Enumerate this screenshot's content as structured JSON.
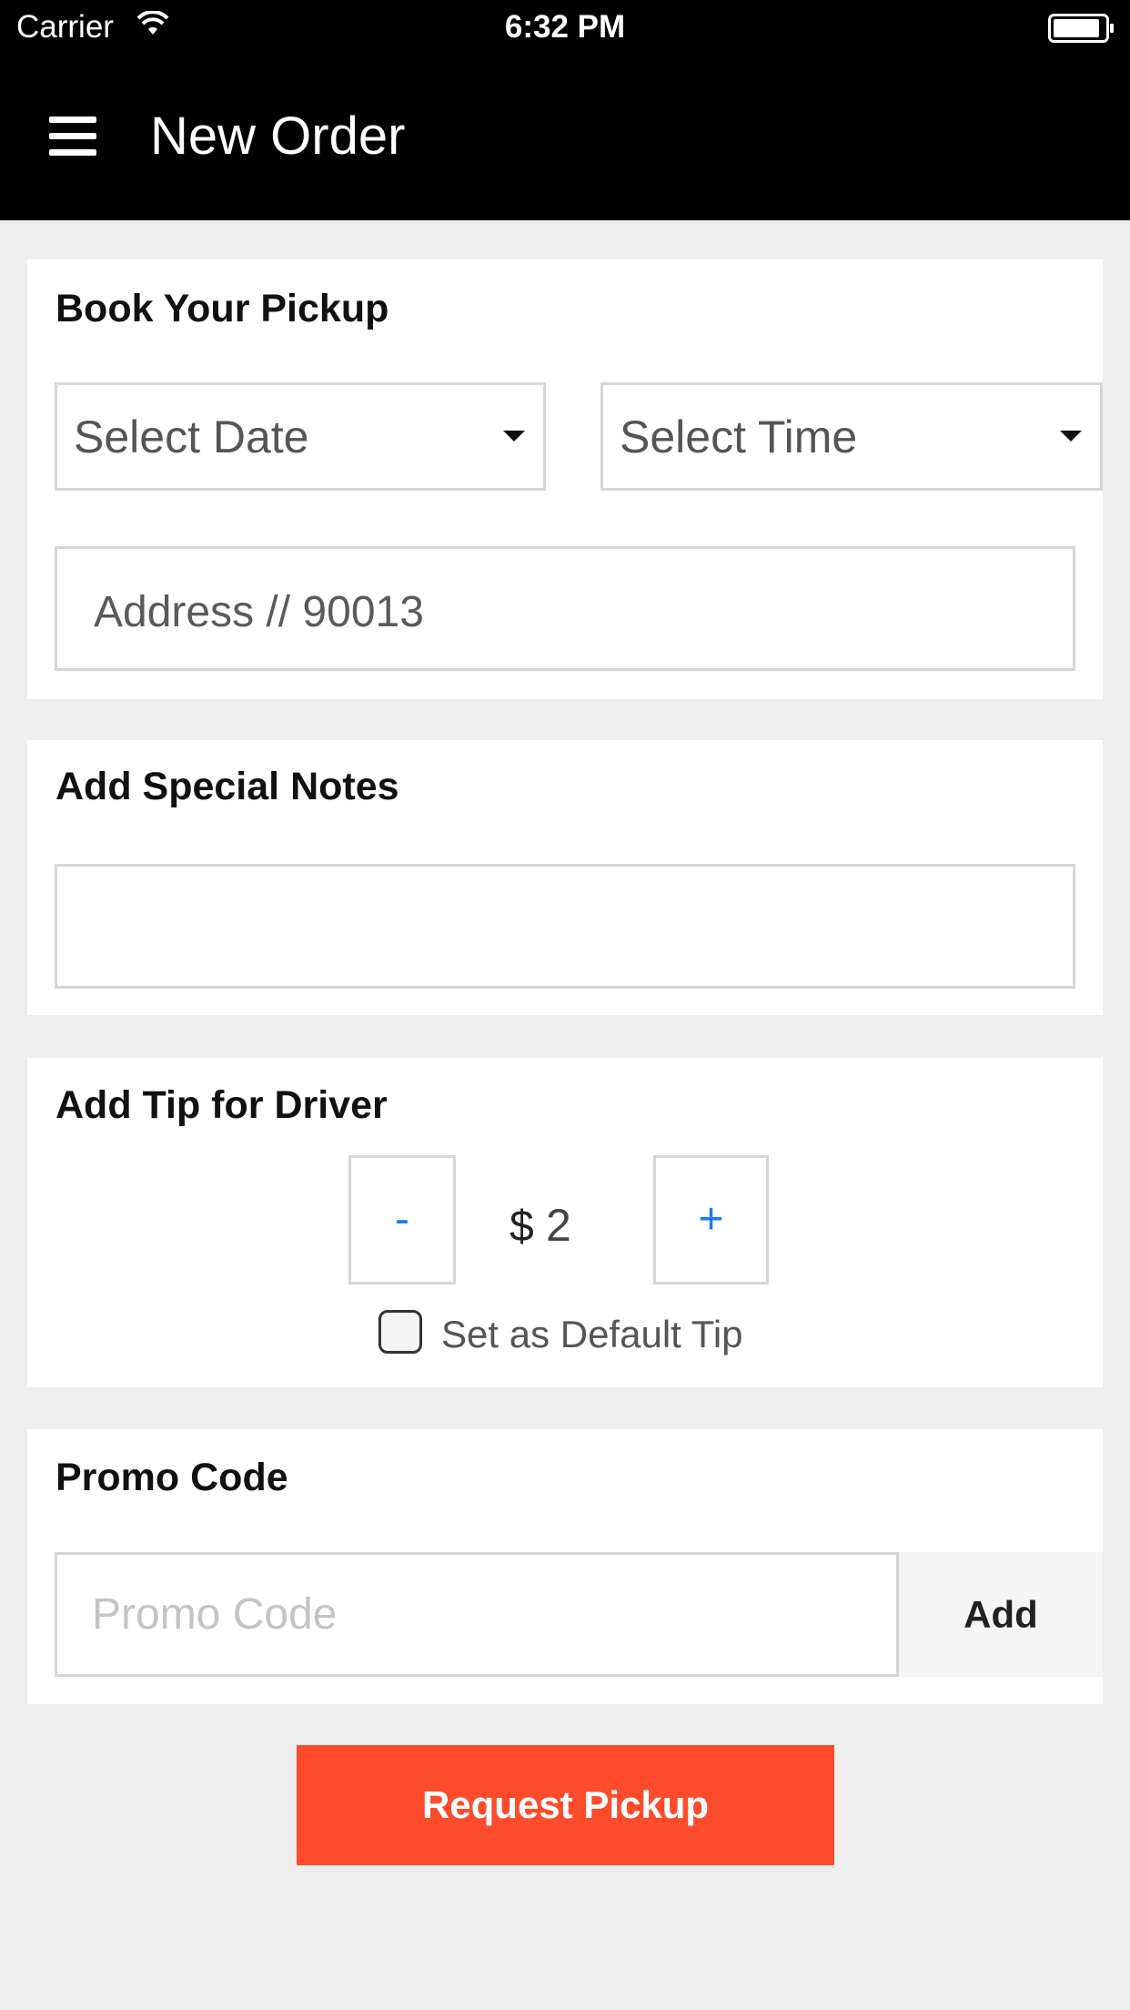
{
  "status_bar": {
    "carrier": "Carrier",
    "time": "6:32 PM"
  },
  "header": {
    "title": "New Order",
    "menu_icon": "hamburger-menu-icon",
    "background": "#000000"
  },
  "pickup": {
    "title": "Book Your Pickup",
    "date_select": "Select Date",
    "time_select": "Select Time",
    "address_placeholder": "Address // 90013"
  },
  "notes": {
    "title": "Add Special Notes",
    "value": ""
  },
  "tip": {
    "title": "Add Tip for Driver",
    "decrement_label": "-",
    "increment_label": "+",
    "currency": "$",
    "amount": "2",
    "default_label": "Set as Default Tip",
    "default_checked": false
  },
  "promo": {
    "title": "Promo Code",
    "placeholder": "Promo Code",
    "add_label": "Add"
  },
  "request_button": {
    "label": "Request Pickup",
    "color": "#fc4c2c"
  },
  "colors": {
    "accent_blue": "#1a7cf0",
    "background": "#eeeeee"
  }
}
